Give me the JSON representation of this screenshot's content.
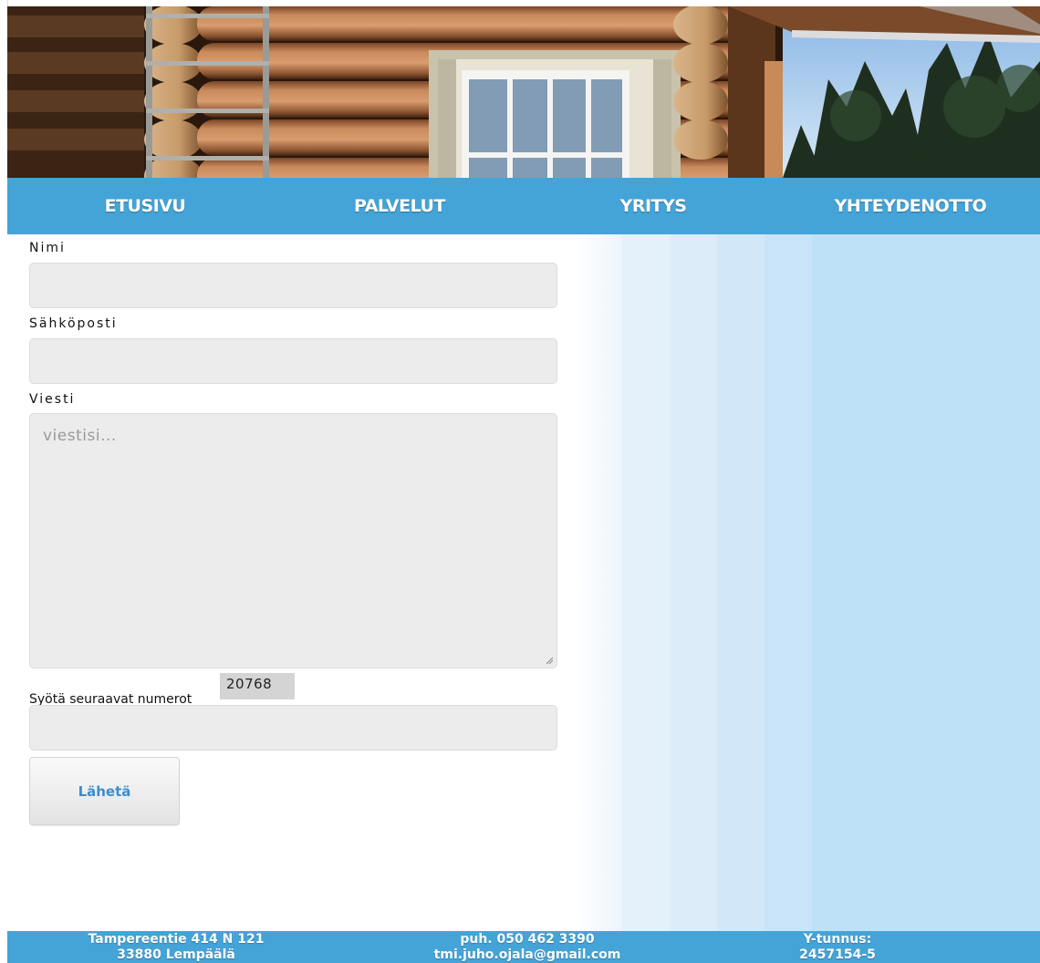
{
  "nav": {
    "items": [
      {
        "label": "ETUSIVU"
      },
      {
        "label": "PALVELUT"
      },
      {
        "label": "YRITYS"
      },
      {
        "label": "YHTEYDENOTTO"
      }
    ]
  },
  "form": {
    "name_label": "Nimi",
    "name_value": "",
    "email_label": "Sähköposti",
    "email_value": "",
    "message_label": "Viesti",
    "message_placeholder": "viestisi...",
    "captcha_label": "Syötä seuraavat numerot",
    "captcha_code": "20768",
    "captcha_value": "",
    "submit_label": "Lähetä"
  },
  "footer": {
    "address_line1": "Tampereentie 414 N 121",
    "address_line2": "33880 Lempäälä",
    "phone": "puh. 050 462 3390",
    "email": "tmi.juho.ojala@gmail.com",
    "business_id_label": "Y-tunnus:",
    "business_id": "2457154-5"
  },
  "colors": {
    "nav_bg": "#44a4d7",
    "footer_bg": "#44a4d7",
    "submit_text": "#3d8ec9",
    "panel_light_blue": "#bfe1f7"
  }
}
